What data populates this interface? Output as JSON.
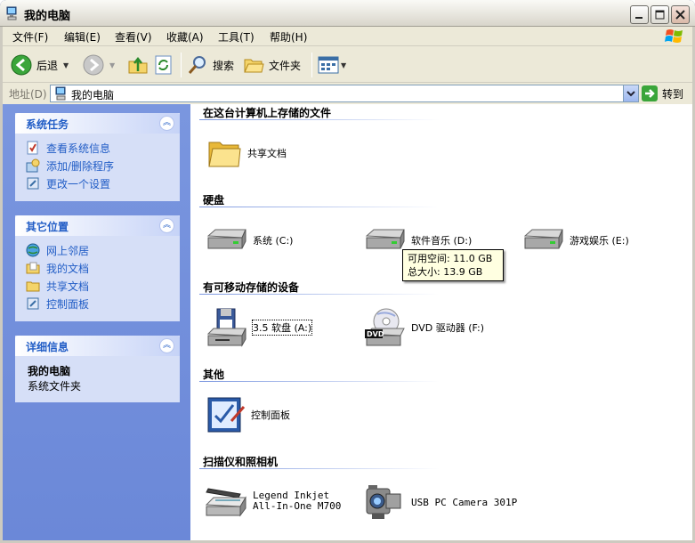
{
  "window": {
    "title": "我的电脑"
  },
  "menu": [
    {
      "label": "文件(F)"
    },
    {
      "label": "编辑(E)"
    },
    {
      "label": "查看(V)"
    },
    {
      "label": "收藏(A)"
    },
    {
      "label": "工具(T)"
    },
    {
      "label": "帮助(H)"
    }
  ],
  "toolbar": {
    "back_label": "后退",
    "search_label": "搜索",
    "folders_label": "文件夹"
  },
  "address": {
    "label": "地址(D)",
    "value": "我的电脑",
    "go_label": "转到"
  },
  "left_pane": {
    "system_tasks": {
      "title": "系统任务",
      "items": [
        {
          "label": "查看系统信息",
          "icon": "system-info-icon"
        },
        {
          "label": "添加/删除程序",
          "icon": "add-remove-programs-icon"
        },
        {
          "label": "更改一个设置",
          "icon": "control-settings-icon"
        }
      ]
    },
    "other_places": {
      "title": "其它位置",
      "items": [
        {
          "label": "网上邻居",
          "icon": "network-places-icon"
        },
        {
          "label": "我的文档",
          "icon": "my-documents-icon"
        },
        {
          "label": "共享文档",
          "icon": "shared-documents-icon"
        },
        {
          "label": "控制面板",
          "icon": "control-panel-icon"
        }
      ]
    },
    "details": {
      "title": "详细信息",
      "name": "我的电脑",
      "type": "系统文件夹"
    }
  },
  "content": {
    "groups": {
      "stored_files": "在这台计算机上存储的文件",
      "hard_disks": "硬盘",
      "removable": "有可移动存储的设备",
      "other": "其他",
      "scanners": "扫描仪和照相机"
    },
    "shared_docs": "共享文档",
    "drives": [
      {
        "label": "系统 (C:)"
      },
      {
        "label": "软件音乐 (D:)"
      },
      {
        "label": "游戏娱乐 (E:)"
      }
    ],
    "floppy": "3.5 软盘 (A:)",
    "dvd": "DVD 驱动器 (F:)",
    "control_panel": "控制面板",
    "scanner_line1": "Legend Inkjet",
    "scanner_line2": "All-In-One M700",
    "camera": "USB PC Camera 301P"
  },
  "tooltip": {
    "free": "可用空间: 11.0 GB",
    "total": "总大小: 13.9 GB"
  },
  "colors": {
    "accent": "#215dc6",
    "pane": "#7a96df",
    "chrome": "#ece9d8"
  }
}
